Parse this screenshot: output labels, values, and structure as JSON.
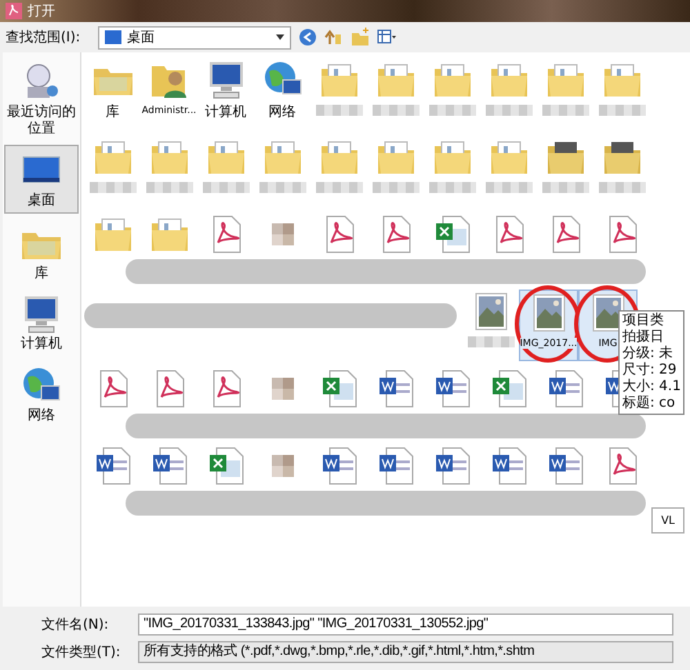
{
  "window": {
    "title": "打开"
  },
  "toolbar": {
    "label": "查找范围(I):",
    "location": "桌面"
  },
  "sidebar": {
    "items": [
      {
        "label": "最近访问的位置",
        "kind": "recent",
        "selected": false
      },
      {
        "label": "桌面",
        "kind": "desktop",
        "selected": true
      },
      {
        "label": "库",
        "kind": "library",
        "selected": false
      },
      {
        "label": "计算机",
        "kind": "computer",
        "selected": false
      },
      {
        "label": "网络",
        "kind": "network",
        "selected": false
      }
    ]
  },
  "grid": {
    "rows": [
      {
        "kind": "plain",
        "items": [
          {
            "kind": "library",
            "label": "库"
          },
          {
            "kind": "user",
            "label": "Administr..."
          },
          {
            "kind": "computer",
            "label": "计算机"
          },
          {
            "kind": "network",
            "label": "网络"
          },
          {
            "kind": "folder",
            "blurred": true
          },
          {
            "kind": "folder",
            "blurred": true
          },
          {
            "kind": "folder",
            "blurred": true
          },
          {
            "kind": "folder",
            "blurred": true
          },
          {
            "kind": "folder",
            "blurred": true
          },
          {
            "kind": "folder",
            "blurred": true
          }
        ]
      },
      {
        "kind": "plain",
        "items": [
          {
            "kind": "folder",
            "blurred": true
          },
          {
            "kind": "folder",
            "blurred": true
          },
          {
            "kind": "folder",
            "blurred": true
          },
          {
            "kind": "folder",
            "blurred": true
          },
          {
            "kind": "folder",
            "blurred": true
          },
          {
            "kind": "folder",
            "blurred": true
          },
          {
            "kind": "folder",
            "blurred": true
          },
          {
            "kind": "folder",
            "blurred": true
          },
          {
            "kind": "darkfolder",
            "blurred": true
          },
          {
            "kind": "darkfolder",
            "blurred": true
          }
        ]
      },
      {
        "kind": "smeared",
        "items": [
          {
            "kind": "folder"
          },
          {
            "kind": "folder"
          },
          {
            "kind": "pdf"
          },
          {
            "kind": "mosaic"
          },
          {
            "kind": "pdf"
          },
          {
            "kind": "pdf"
          },
          {
            "kind": "excel"
          },
          {
            "kind": "pdf"
          },
          {
            "kind": "pdf"
          },
          {
            "kind": "pdf"
          }
        ]
      },
      {
        "kind": "smeared-lead",
        "items": [
          {
            "kind": "photo",
            "blurred": true
          },
          {
            "kind": "photo",
            "label": "IMG_2017...",
            "selected": true,
            "circled": true
          },
          {
            "kind": "photo",
            "label": "IMG",
            "selected": true,
            "circled": true,
            "tooltip": [
              "项目类",
              "拍摄日",
              "分级: 未",
              "尺寸: 29",
              "大小: 4.1",
              "标题: co"
            ]
          }
        ]
      },
      {
        "kind": "smeared",
        "items": [
          {
            "kind": "pdf"
          },
          {
            "kind": "pdf"
          },
          {
            "kind": "pdf"
          },
          {
            "kind": "mosaic"
          },
          {
            "kind": "excel"
          },
          {
            "kind": "word"
          },
          {
            "kind": "word"
          },
          {
            "kind": "excel"
          },
          {
            "kind": "word"
          },
          {
            "kind": "word"
          }
        ]
      },
      {
        "kind": "smeared",
        "items": [
          {
            "kind": "word"
          },
          {
            "kind": "word"
          },
          {
            "kind": "excel"
          },
          {
            "kind": "mosaic"
          },
          {
            "kind": "word"
          },
          {
            "kind": "word"
          },
          {
            "kind": "word"
          },
          {
            "kind": "word"
          },
          {
            "kind": "word"
          },
          {
            "kind": "pdf"
          }
        ]
      }
    ],
    "popup": "VL"
  },
  "fields": [
    {
      "label": "文件名(N):",
      "kind": "input",
      "value": "\"IMG_20170331_133843.jpg\" \"IMG_20170331_130552.jpg\""
    },
    {
      "label": "文件类型(T):",
      "kind": "select",
      "value": "所有支持的格式 (*.pdf,*.dwg,*.bmp,*.rle,*.dib,*.gif,*.html,*.htm,*.shtm"
    }
  ]
}
